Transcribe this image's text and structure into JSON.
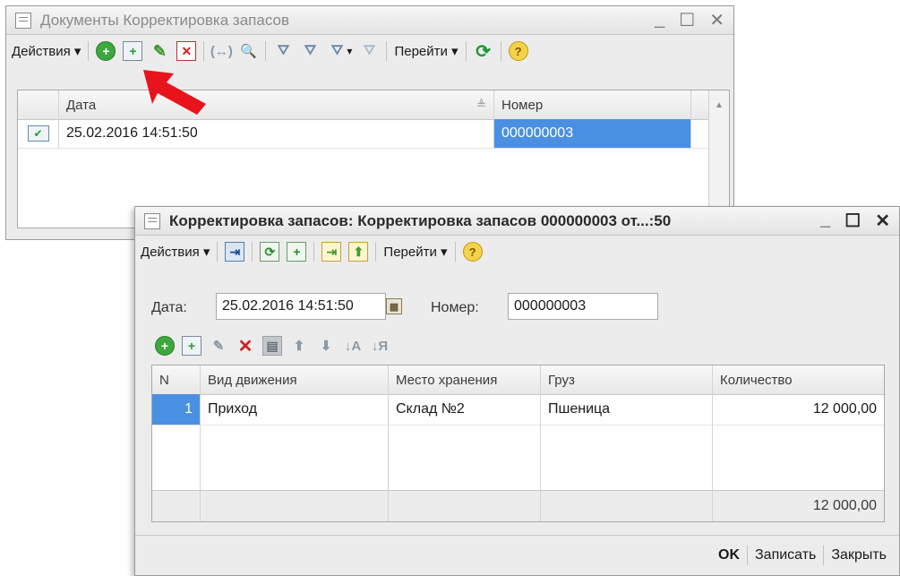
{
  "list_window": {
    "title": "Документы Корректировка запасов",
    "win_controls": [
      "_",
      "☐",
      "✕"
    ],
    "toolbar": {
      "actions": "Действия ▾",
      "goto": "Перейти ▾",
      "glyph_select": "▾"
    },
    "columns": [
      "Дата",
      "Номер"
    ],
    "sort_indicator": "≜",
    "rows": [
      {
        "date": "25.02.2016 14:51:50",
        "number": "000000003"
      }
    ]
  },
  "doc_window": {
    "title": "Корректировка запасов: Корректировка запасов 000000003 от...:50",
    "win_controls": [
      "_",
      "☐",
      "✕"
    ],
    "toolbar": {
      "actions": "Действия ▾",
      "goto": "Перейти ▾"
    },
    "form": {
      "date_label": "Дата:",
      "date_value": "25.02.2016 14:51:50",
      "number_label": "Номер:",
      "number_value": "000000003"
    },
    "table": {
      "columns": [
        "N",
        "Вид движения",
        "Место хранения",
        "Груз",
        "Количество"
      ],
      "rows": [
        {
          "n": "1",
          "movement": "Приход",
          "storage": "Склад №2",
          "cargo": "Пшеница",
          "qty": "12 000,00"
        }
      ],
      "total_qty": "12 000,00"
    },
    "buttons": {
      "ok": "OK",
      "save": "Записать",
      "close": "Закрыть"
    }
  },
  "icons": {
    "add": "+",
    "copy": "+",
    "edit": "✎",
    "delete": "✕",
    "ref": "(↔)",
    "find": "🔍",
    "filter": "⛛",
    "refresh": "⟳",
    "help": "?",
    "post": "⇥",
    "up": "⬆",
    "down": "⬇",
    "sort_asc": "↓A",
    "sort_desc": "↓Я",
    "save_sq": "▤",
    "calendar": "▦",
    "posted_doc": "✔"
  },
  "colors": {
    "accent_selection": "#4a90e2",
    "pointer_arrow": "#e8141c",
    "add_green": "#3da83d",
    "delete_red": "#d02020"
  }
}
